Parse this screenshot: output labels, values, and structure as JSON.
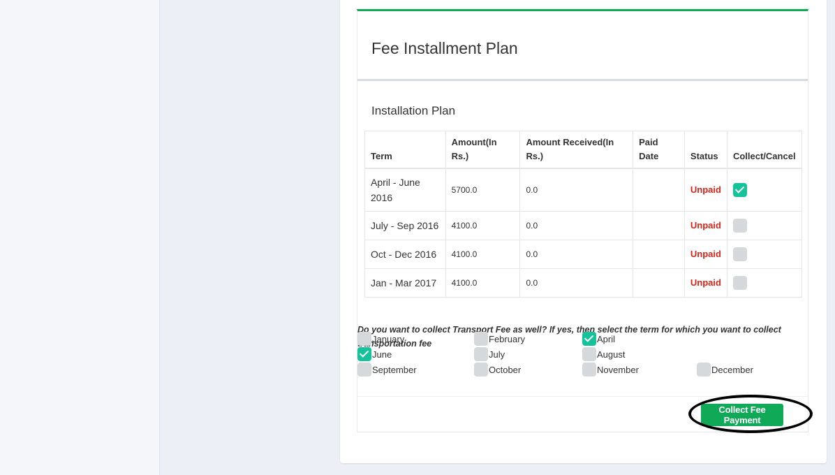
{
  "panel": {
    "title": "Fee Installment Plan",
    "section_title": "Installation Plan"
  },
  "table": {
    "headers": [
      "Term",
      "Amount(In Rs.)",
      "Amount Received(In Rs.)",
      "Paid Date",
      "Status",
      "Collect/Cancel"
    ],
    "rows": [
      {
        "term": "April - June 2016",
        "amount": "5700.0",
        "received": "0.0",
        "paid_date": "",
        "status": "Unpaid",
        "checked": true
      },
      {
        "term": "July - Sep 2016",
        "amount": "4100.0",
        "received": "0.0",
        "paid_date": "",
        "status": "Unpaid",
        "checked": false
      },
      {
        "term": "Oct - Dec 2016",
        "amount": "4100.0",
        "received": "0.0",
        "paid_date": "",
        "status": "Unpaid",
        "checked": false
      },
      {
        "term": "Jan - Mar 2017",
        "amount": "4100.0",
        "received": "0.0",
        "paid_date": "",
        "status": "Unpaid",
        "checked": false
      }
    ]
  },
  "transport": {
    "question": "Do you want to collect Transport Fee as well? If yes, then select the term for which you want to collect transportation fee",
    "months": [
      {
        "label": "January",
        "checked": false
      },
      {
        "label": "February",
        "checked": false
      },
      {
        "label": "April",
        "checked": true
      },
      {
        "label": "June",
        "checked": true
      },
      {
        "label": "July",
        "checked": false
      },
      {
        "label": "August",
        "checked": false
      },
      {
        "label": "September",
        "checked": false
      },
      {
        "label": "October",
        "checked": false
      },
      {
        "label": "November",
        "checked": false
      },
      {
        "label": "December",
        "checked": false
      }
    ]
  },
  "actions": {
    "collect_label": "Collect Fee Payment"
  },
  "colors": {
    "accent": "#0fa958",
    "checkbox_on": "#14c39a",
    "unpaid": "#d9261c"
  },
  "icons": {
    "checked": "check-icon"
  }
}
